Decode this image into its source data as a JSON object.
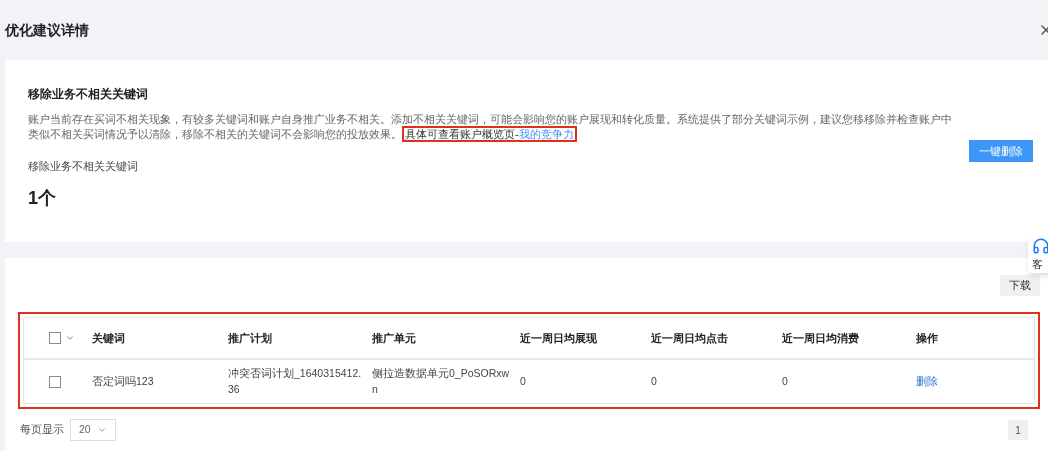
{
  "header": {
    "title": "优化建议详情"
  },
  "summary": {
    "title": "移除业务不相关关键词",
    "description": {
      "text": "账户当前存在买词不相关现象，有较多关键词和账户自身推广业务不相关。添加不相关关键词，可能会影响您的账户展现和转化质量。系统提供了部分关键词示例，建议您移移除并检查账户中类似不相关买词情况予以清除，移除不相关的关键词不会影响您的投放效果。",
      "highlight_text": "具体可查看账户概览页-",
      "link": "我的竞争力",
      "highlighted": true
    },
    "metric_label": "移除业务不相关关键词",
    "metric_value": "1个",
    "action_button": "一键删除"
  },
  "support_widget": {
    "label": "客"
  },
  "download_button": "下载",
  "table": {
    "highlighted": true,
    "select_all": {
      "checked": false
    },
    "columns": [
      "关键词",
      "推广计划",
      "推广单元",
      "近一周日均展现",
      "近一周日均点击",
      "近一周日均消费",
      "操作"
    ],
    "rows": [
      {
        "checked": false,
        "keyword": "否定词吗123",
        "plan": "冲突否词计划_1640315412.36",
        "unit": "侧拉造数据单元0_PoSORxwn",
        "impressions": "0",
        "clicks": "0",
        "cost": "0",
        "action": "删除"
      }
    ]
  },
  "pagination": {
    "page_size_label": "每页显示",
    "page_size": "20",
    "pages": [
      {
        "label": "1",
        "selected": true
      }
    ]
  }
}
